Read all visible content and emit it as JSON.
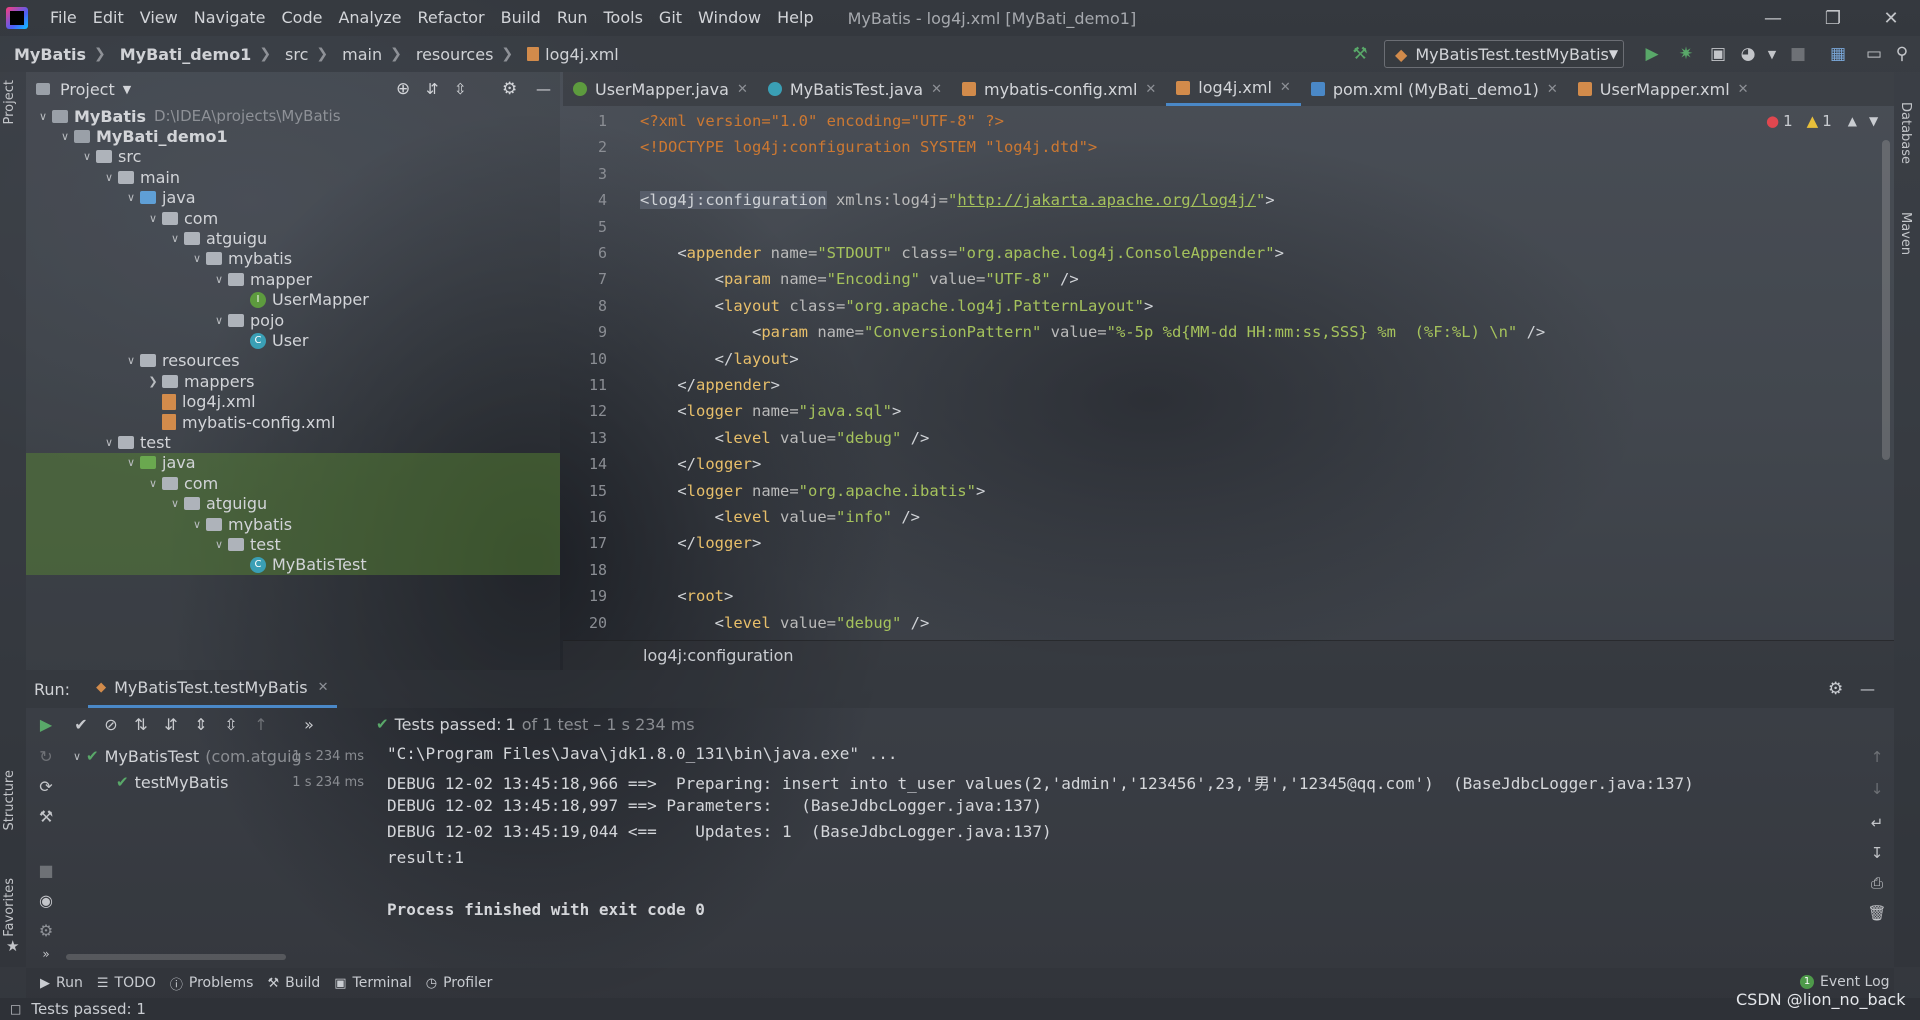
{
  "menu": {
    "items": [
      "File",
      "Edit",
      "View",
      "Navigate",
      "Code",
      "Analyze",
      "Refactor",
      "Build",
      "Run",
      "Tools",
      "Git",
      "Window",
      "Help"
    ],
    "window_title": "MyBatis - log4j.xml [MyBati_demo1]"
  },
  "navbar": {
    "crumbs": [
      "MyBatis",
      "MyBati_demo1",
      "src",
      "main",
      "resources",
      "log4j.xml"
    ],
    "run_config": "MyBatisTest.testMyBatis"
  },
  "side_tabs": {
    "left": [
      "Project",
      "Structure",
      "Favorites"
    ],
    "right": [
      "Database",
      "Maven"
    ]
  },
  "project": {
    "header": "Project",
    "tree": [
      {
        "label": "MyBatis",
        "hint": "D:\\IDEA\\projects\\MyBatis",
        "level": 0,
        "icon": "folder-dark",
        "arrow": "down",
        "bold": true
      },
      {
        "label": "MyBati_demo1",
        "level": 1,
        "icon": "folder-dark",
        "arrow": "down",
        "bold": true
      },
      {
        "label": "src",
        "level": 2,
        "icon": "folder-grey",
        "arrow": "down"
      },
      {
        "label": "main",
        "level": 3,
        "icon": "folder-grey",
        "arrow": "down"
      },
      {
        "label": "java",
        "level": 4,
        "icon": "folder-blue",
        "arrow": "down"
      },
      {
        "label": "com",
        "level": 5,
        "icon": "folder-grey",
        "arrow": "down"
      },
      {
        "label": "atguigu",
        "level": 6,
        "icon": "folder-grey",
        "arrow": "down"
      },
      {
        "label": "mybatis",
        "level": 7,
        "icon": "folder-grey",
        "arrow": "down"
      },
      {
        "label": "mapper",
        "level": 8,
        "icon": "folder-grey",
        "arrow": "down"
      },
      {
        "label": "UserMapper",
        "level": 9,
        "icon": "interface",
        "arrow": "none"
      },
      {
        "label": "pojo",
        "level": 8,
        "icon": "folder-grey",
        "arrow": "down"
      },
      {
        "label": "User",
        "level": 9,
        "icon": "class",
        "arrow": "none"
      },
      {
        "label": "resources",
        "level": 4,
        "icon": "folder-grey",
        "arrow": "down"
      },
      {
        "label": "mappers",
        "level": 5,
        "icon": "folder-grey",
        "arrow": "right"
      },
      {
        "label": "log4j.xml",
        "level": 5,
        "icon": "xml",
        "arrow": "none"
      },
      {
        "label": "mybatis-config.xml",
        "level": 5,
        "icon": "xml",
        "arrow": "none"
      },
      {
        "label": "test",
        "level": 3,
        "icon": "folder-grey",
        "arrow": "down"
      },
      {
        "label": "java",
        "level": 4,
        "icon": "folder-green",
        "arrow": "down",
        "highlight": true
      },
      {
        "label": "com",
        "level": 5,
        "icon": "folder-grey",
        "arrow": "down",
        "highlight": true
      },
      {
        "label": "atguigu",
        "level": 6,
        "icon": "folder-grey",
        "arrow": "down",
        "highlight": true
      },
      {
        "label": "mybatis",
        "level": 7,
        "icon": "folder-grey",
        "arrow": "down",
        "highlight": true
      },
      {
        "label": "test",
        "level": 8,
        "icon": "folder-grey",
        "arrow": "down",
        "highlight": true
      },
      {
        "label": "MyBatisTest",
        "level": 9,
        "icon": "class",
        "arrow": "none",
        "highlight": true
      }
    ]
  },
  "editor": {
    "tabs": [
      {
        "label": "UserMapper.java",
        "icon": "interface"
      },
      {
        "label": "MyBatisTest.java",
        "icon": "class"
      },
      {
        "label": "mybatis-config.xml",
        "icon": "xml"
      },
      {
        "label": "log4j.xml",
        "icon": "xml",
        "active": true
      },
      {
        "label": "pom.xml (MyBati_demo1)",
        "icon": "maven"
      },
      {
        "label": "UserMapper.xml",
        "icon": "xml"
      }
    ],
    "inspection": {
      "errors": "1",
      "warnings": "1"
    },
    "lines": [
      [
        [
          "pi",
          "<?xml version=\"1.0\" encoding=\"UTF-8\" ?>"
        ]
      ],
      [
        [
          "pi",
          "<!DOCTYPE log4j:configuration SYSTEM \"log4j.dtd\">"
        ]
      ],
      [],
      [
        [
          "sel",
          "<log4j:configuration"
        ],
        [
          "attr",
          " xmlns:log4j="
        ],
        [
          "val",
          "\""
        ],
        [
          "url",
          "http://jakarta.apache.org/log4j/"
        ],
        [
          "val",
          "\""
        ],
        [
          "br",
          ">"
        ]
      ],
      [],
      [
        [
          "br",
          "    <"
        ],
        [
          "tag",
          "appender"
        ],
        [
          "attr",
          " name="
        ],
        [
          "val",
          "\"STDOUT\""
        ],
        [
          "attr",
          " class="
        ],
        [
          "val",
          "\"org.apache.log4j.ConsoleAppender\""
        ],
        [
          "br",
          ">"
        ]
      ],
      [
        [
          "br",
          "        <"
        ],
        [
          "tag",
          "param"
        ],
        [
          "attr",
          " name="
        ],
        [
          "val",
          "\"Encoding\""
        ],
        [
          "attr",
          " value="
        ],
        [
          "val",
          "\"UTF-8\""
        ],
        [
          "br",
          " />"
        ]
      ],
      [
        [
          "br",
          "        <"
        ],
        [
          "tag",
          "layout"
        ],
        [
          "attr",
          " class="
        ],
        [
          "val",
          "\"org.apache.log4j.PatternLayout\""
        ],
        [
          "br",
          ">"
        ]
      ],
      [
        [
          "br",
          "            <"
        ],
        [
          "tag",
          "param"
        ],
        [
          "attr",
          " name="
        ],
        [
          "val",
          "\"ConversionPattern\""
        ],
        [
          "attr",
          " value="
        ],
        [
          "val",
          "\"%-5p %d{MM-dd HH:mm:ss,SSS} %m  (%F:%L) \\n\""
        ],
        [
          "br",
          " />"
        ]
      ],
      [
        [
          "br",
          "        </"
        ],
        [
          "tag",
          "layout"
        ],
        [
          "br",
          ">"
        ]
      ],
      [
        [
          "br",
          "    </"
        ],
        [
          "tag",
          "appender"
        ],
        [
          "br",
          ">"
        ]
      ],
      [
        [
          "br",
          "    <"
        ],
        [
          "tag",
          "logger"
        ],
        [
          "attr",
          " name="
        ],
        [
          "val",
          "\"java.sql\""
        ],
        [
          "br",
          ">"
        ]
      ],
      [
        [
          "br",
          "        <"
        ],
        [
          "tag",
          "level"
        ],
        [
          "attr",
          " value="
        ],
        [
          "val",
          "\"debug\""
        ],
        [
          "br",
          " />"
        ]
      ],
      [
        [
          "br",
          "    </"
        ],
        [
          "tag",
          "logger"
        ],
        [
          "br",
          ">"
        ]
      ],
      [
        [
          "br",
          "    <"
        ],
        [
          "tag",
          "logger"
        ],
        [
          "attr",
          " name="
        ],
        [
          "val",
          "\"org.apache.ibatis\""
        ],
        [
          "br",
          ">"
        ]
      ],
      [
        [
          "br",
          "        <"
        ],
        [
          "tag",
          "level"
        ],
        [
          "attr",
          " value="
        ],
        [
          "val",
          "\"info\""
        ],
        [
          "br",
          " />"
        ]
      ],
      [
        [
          "br",
          "    </"
        ],
        [
          "tag",
          "logger"
        ],
        [
          "br",
          ">"
        ]
      ],
      [],
      [
        [
          "br",
          "    <"
        ],
        [
          "tag",
          "root"
        ],
        [
          "br",
          ">"
        ]
      ],
      [
        [
          "br",
          "        <"
        ],
        [
          "tag",
          "level"
        ],
        [
          "attr",
          " value="
        ],
        [
          "val",
          "\"debug\""
        ],
        [
          "br",
          " />"
        ]
      ]
    ],
    "breadcrumb": "log4j:configuration"
  },
  "run": {
    "label": "Run:",
    "tab": "MyBatisTest.testMyBatis",
    "status_prefix": "Tests passed:",
    "status_count": "1",
    "status_detail": "of 1 test – 1 s 234 ms",
    "tests": [
      {
        "label": "MyBatisTest",
        "detail": "(com.atguig",
        "time": "1 s 234 ms",
        "level": 0
      },
      {
        "label": "testMyBatis",
        "detail": "",
        "time": "1 s 234 ms",
        "level": 1
      }
    ],
    "console": [
      {
        "text": "\"C:\\Program Files\\Java\\jdk1.8.0_131\\bin\\java.exe\" ...",
        "bold": false
      },
      {
        "text": "DEBUG 12-02 13:45:18,966 ==>  Preparing: insert into t_user values(2,'admin','123456',23,'男','12345@qq.com')  (BaseJdbcLogger.java:137)",
        "bold": false
      },
      {
        "text": "DEBUG 12-02 13:45:18,997 ==> Parameters:   (BaseJdbcLogger.java:137)",
        "bold": false
      },
      {
        "text": "DEBUG 12-02 13:45:19,044 <==    Updates: 1  (BaseJdbcLogger.java:137)",
        "bold": false
      },
      {
        "text": "result:1",
        "bold": false
      },
      {
        "text": "",
        "bold": false
      },
      {
        "text": "Process finished with exit code 0",
        "bold": true
      }
    ]
  },
  "bottom_tabs": [
    "Run",
    "TODO",
    "Problems",
    "Build",
    "Terminal",
    "Profiler"
  ],
  "event_log": "Event Log",
  "event_count": "1",
  "status_bar": "Tests passed: 1",
  "watermark": "CSDN @lion_no_back"
}
